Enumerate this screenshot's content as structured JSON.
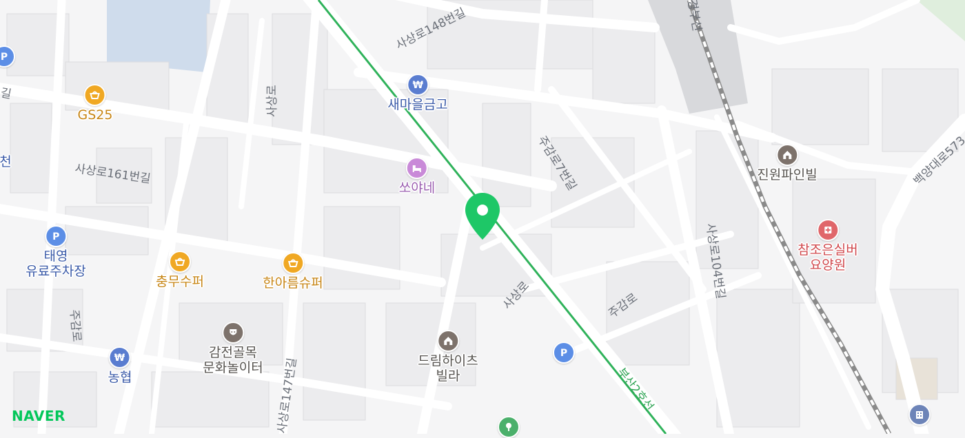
{
  "map": {
    "provider_logo": "NAVER",
    "colors": {
      "background": "#f5f5f6",
      "road": "#ffffff",
      "water": "#cfdcec",
      "subway_line": "#2fb25a",
      "railway": "#8a8a8a",
      "pin": "#1ec767"
    },
    "road_labels": {
      "r1": "사상로148번길",
      "r2": "사상로",
      "r3": "사상로161번길",
      "r4": "주감로7번길",
      "r5": "사상로",
      "r6": "주감로",
      "r7": "사상로104번길",
      "r8": "사상로147번길",
      "r9": "백양대로573",
      "r10": "주감로",
      "r11": "길",
      "r12": "부산2호선",
      "r13": "경부선"
    },
    "pois": {
      "saemaeul": {
        "label": "새마을금고",
        "icon": "bank-icon"
      },
      "gs25": {
        "label": "GS25",
        "icon": "convenience-store-icon"
      },
      "ssoyane": {
        "label": "쏘야네",
        "icon": "lodging-icon"
      },
      "taeyoung": {
        "label_line1": "태영",
        "label_line2": "유료주차장",
        "icon": "parking-icon"
      },
      "chungmu": {
        "label": "충무수퍼",
        "icon": "convenience-store-icon"
      },
      "hanareum": {
        "label": "한아름슈퍼",
        "icon": "convenience-store-icon"
      },
      "gamjeon": {
        "label_line1": "감전골목",
        "label_line2": "문화놀이터",
        "icon": "culture-icon"
      },
      "nonghyup": {
        "label": "농협",
        "icon": "bank-icon"
      },
      "dreamheights": {
        "label_line1": "드림하이츠",
        "label_line2": "빌라",
        "icon": "apartment-icon"
      },
      "jinwon": {
        "label": "진원파인빌",
        "icon": "apartment-icon"
      },
      "chamjoeun": {
        "label_line1": "참조은실버",
        "label_line2": "요양원",
        "icon": "hospital-icon"
      },
      "parking_center": {
        "icon": "parking-icon"
      },
      "parking_left": {
        "icon": "parking-icon"
      },
      "cheon_partial": {
        "label_line1": "",
        "label_line2": "천"
      }
    }
  }
}
